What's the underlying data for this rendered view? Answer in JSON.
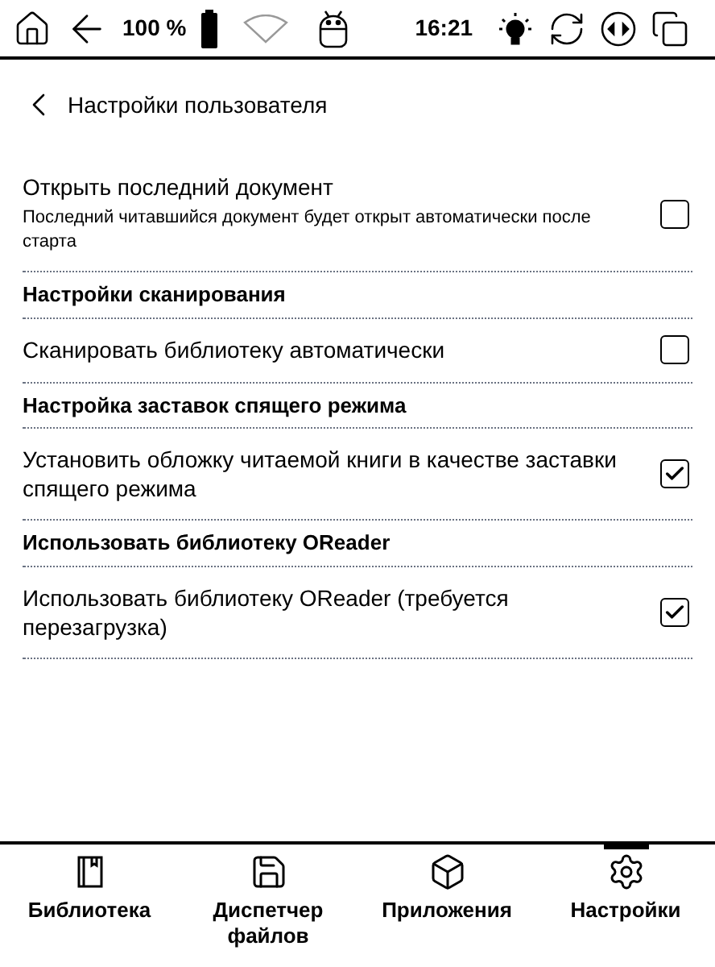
{
  "status_bar": {
    "battery": "100 %",
    "time": "16:21"
  },
  "header": {
    "title": "Настройки пользователя"
  },
  "sections": [
    {
      "items": [
        {
          "title": "Открыть последний документ",
          "subtitle": "Последний читавшийся документ будет открыт автоматически после старта",
          "checked": false
        }
      ]
    },
    {
      "title": "Настройки сканирования",
      "items": [
        {
          "title": "Сканировать библиотеку автоматически",
          "checked": false
        }
      ]
    },
    {
      "title": "Настройка заставок спящего режима",
      "items": [
        {
          "title": "Установить обложку читаемой книги в качестве заставки спящего режима",
          "checked": true
        }
      ]
    },
    {
      "title": "Использовать библиотеку OReader",
      "items": [
        {
          "title": "Использовать библиотеку OReader (требуется перезагрузка)",
          "checked": true
        }
      ]
    }
  ],
  "nav": [
    {
      "kind": "library",
      "label": "Библиотека",
      "selected": false
    },
    {
      "kind": "files",
      "label": "Диспетчер файлов",
      "selected": false
    },
    {
      "kind": "apps",
      "label": "Приложения",
      "selected": false
    },
    {
      "kind": "settings",
      "label": "Настройки",
      "selected": true
    }
  ]
}
